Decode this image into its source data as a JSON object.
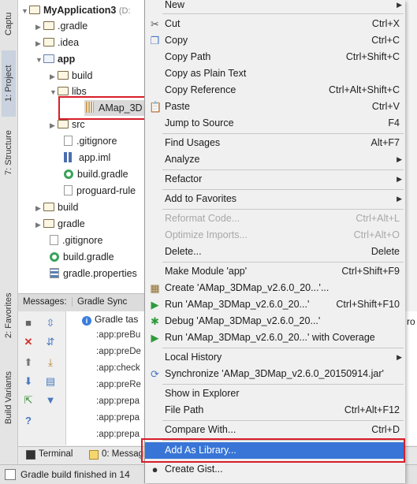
{
  "side_tabs": {
    "captures": "Captu",
    "project": "1: Project",
    "structure": "7: Structure",
    "favorites": "2: Favorites",
    "build_variants": "Build Variants"
  },
  "tree": {
    "root": "MyApplication3",
    "root_path": "(D:",
    "items": [
      {
        "label": ".gradle"
      },
      {
        "label": ".idea"
      },
      {
        "label": "app"
      },
      {
        "label": "build"
      },
      {
        "label": "libs"
      },
      {
        "label": "AMap_3D"
      },
      {
        "label": "src"
      },
      {
        "label": ".gitignore"
      },
      {
        "label": "app.iml"
      },
      {
        "label": "build.gradle"
      },
      {
        "label": "proguard-rule"
      },
      {
        "label": "build"
      },
      {
        "label": "gradle"
      },
      {
        "label": ".gitignore"
      },
      {
        "label": "build.gradle"
      },
      {
        "label": "gradle.properties"
      }
    ]
  },
  "messages_bar": {
    "messages": "Messages:",
    "gradle_sync": "Gradle Sync"
  },
  "log": {
    "header": "Gradle tas",
    "lines": [
      ":app:preBu",
      ":app:preDe",
      ":app:check",
      ":app:preRe",
      ":app:prepa",
      ":app:prepa",
      ":app:prepa",
      ":app:prepa"
    ],
    "right_fragment": "ro"
  },
  "bottom_tabs": {
    "terminal": "Terminal",
    "messages": "0: Messag"
  },
  "status": {
    "text": "Gradle build finished in 14"
  },
  "menu": {
    "items": [
      {
        "label": "New",
        "sc": "",
        "sub": true
      },
      {
        "label": "Cut",
        "sc": "Ctrl+X"
      },
      {
        "label": "Copy",
        "sc": "Ctrl+C"
      },
      {
        "label": "Copy Path",
        "sc": "Ctrl+Shift+C"
      },
      {
        "label": "Copy as Plain Text",
        "sc": ""
      },
      {
        "label": "Copy Reference",
        "sc": "Ctrl+Alt+Shift+C"
      },
      {
        "label": "Paste",
        "sc": "Ctrl+V"
      },
      {
        "label": "Jump to Source",
        "sc": "F4"
      },
      {
        "label": "Find Usages",
        "sc": "Alt+F7"
      },
      {
        "label": "Analyze",
        "sc": "",
        "sub": true
      },
      {
        "label": "Refactor",
        "sc": "",
        "sub": true
      },
      {
        "label": "Add to Favorites",
        "sc": "",
        "sub": true
      },
      {
        "label": "Reformat Code...",
        "sc": "Ctrl+Alt+L"
      },
      {
        "label": "Optimize Imports...",
        "sc": "Ctrl+Alt+O"
      },
      {
        "label": "Delete...",
        "sc": "Delete"
      },
      {
        "label": "Make Module 'app'",
        "sc": "Ctrl+Shift+F9"
      },
      {
        "label": "Create 'AMap_3DMap_v2.6.0_20...'...",
        "sc": ""
      },
      {
        "label": "Run 'AMap_3DMap_v2.6.0_20...'",
        "sc": "Ctrl+Shift+F10"
      },
      {
        "label": "Debug 'AMap_3DMap_v2.6.0_20...'",
        "sc": ""
      },
      {
        "label": "Run 'AMap_3DMap_v2.6.0_20...' with Coverage",
        "sc": ""
      },
      {
        "label": "Local History",
        "sc": "",
        "sub": true
      },
      {
        "label": "Synchronize 'AMap_3DMap_v2.6.0_20150914.jar'",
        "sc": ""
      },
      {
        "label": "Show in Explorer",
        "sc": ""
      },
      {
        "label": "File Path",
        "sc": "Ctrl+Alt+F12"
      },
      {
        "label": "Compare With...",
        "sc": "Ctrl+D"
      },
      {
        "label": "Add As Library...",
        "sc": ""
      },
      {
        "label": "Create Gist...",
        "sc": ""
      }
    ]
  },
  "colors": {
    "highlight": "#3875d7",
    "annotation_red": "#d81e2a",
    "gradle_green": "#3aa35b"
  }
}
